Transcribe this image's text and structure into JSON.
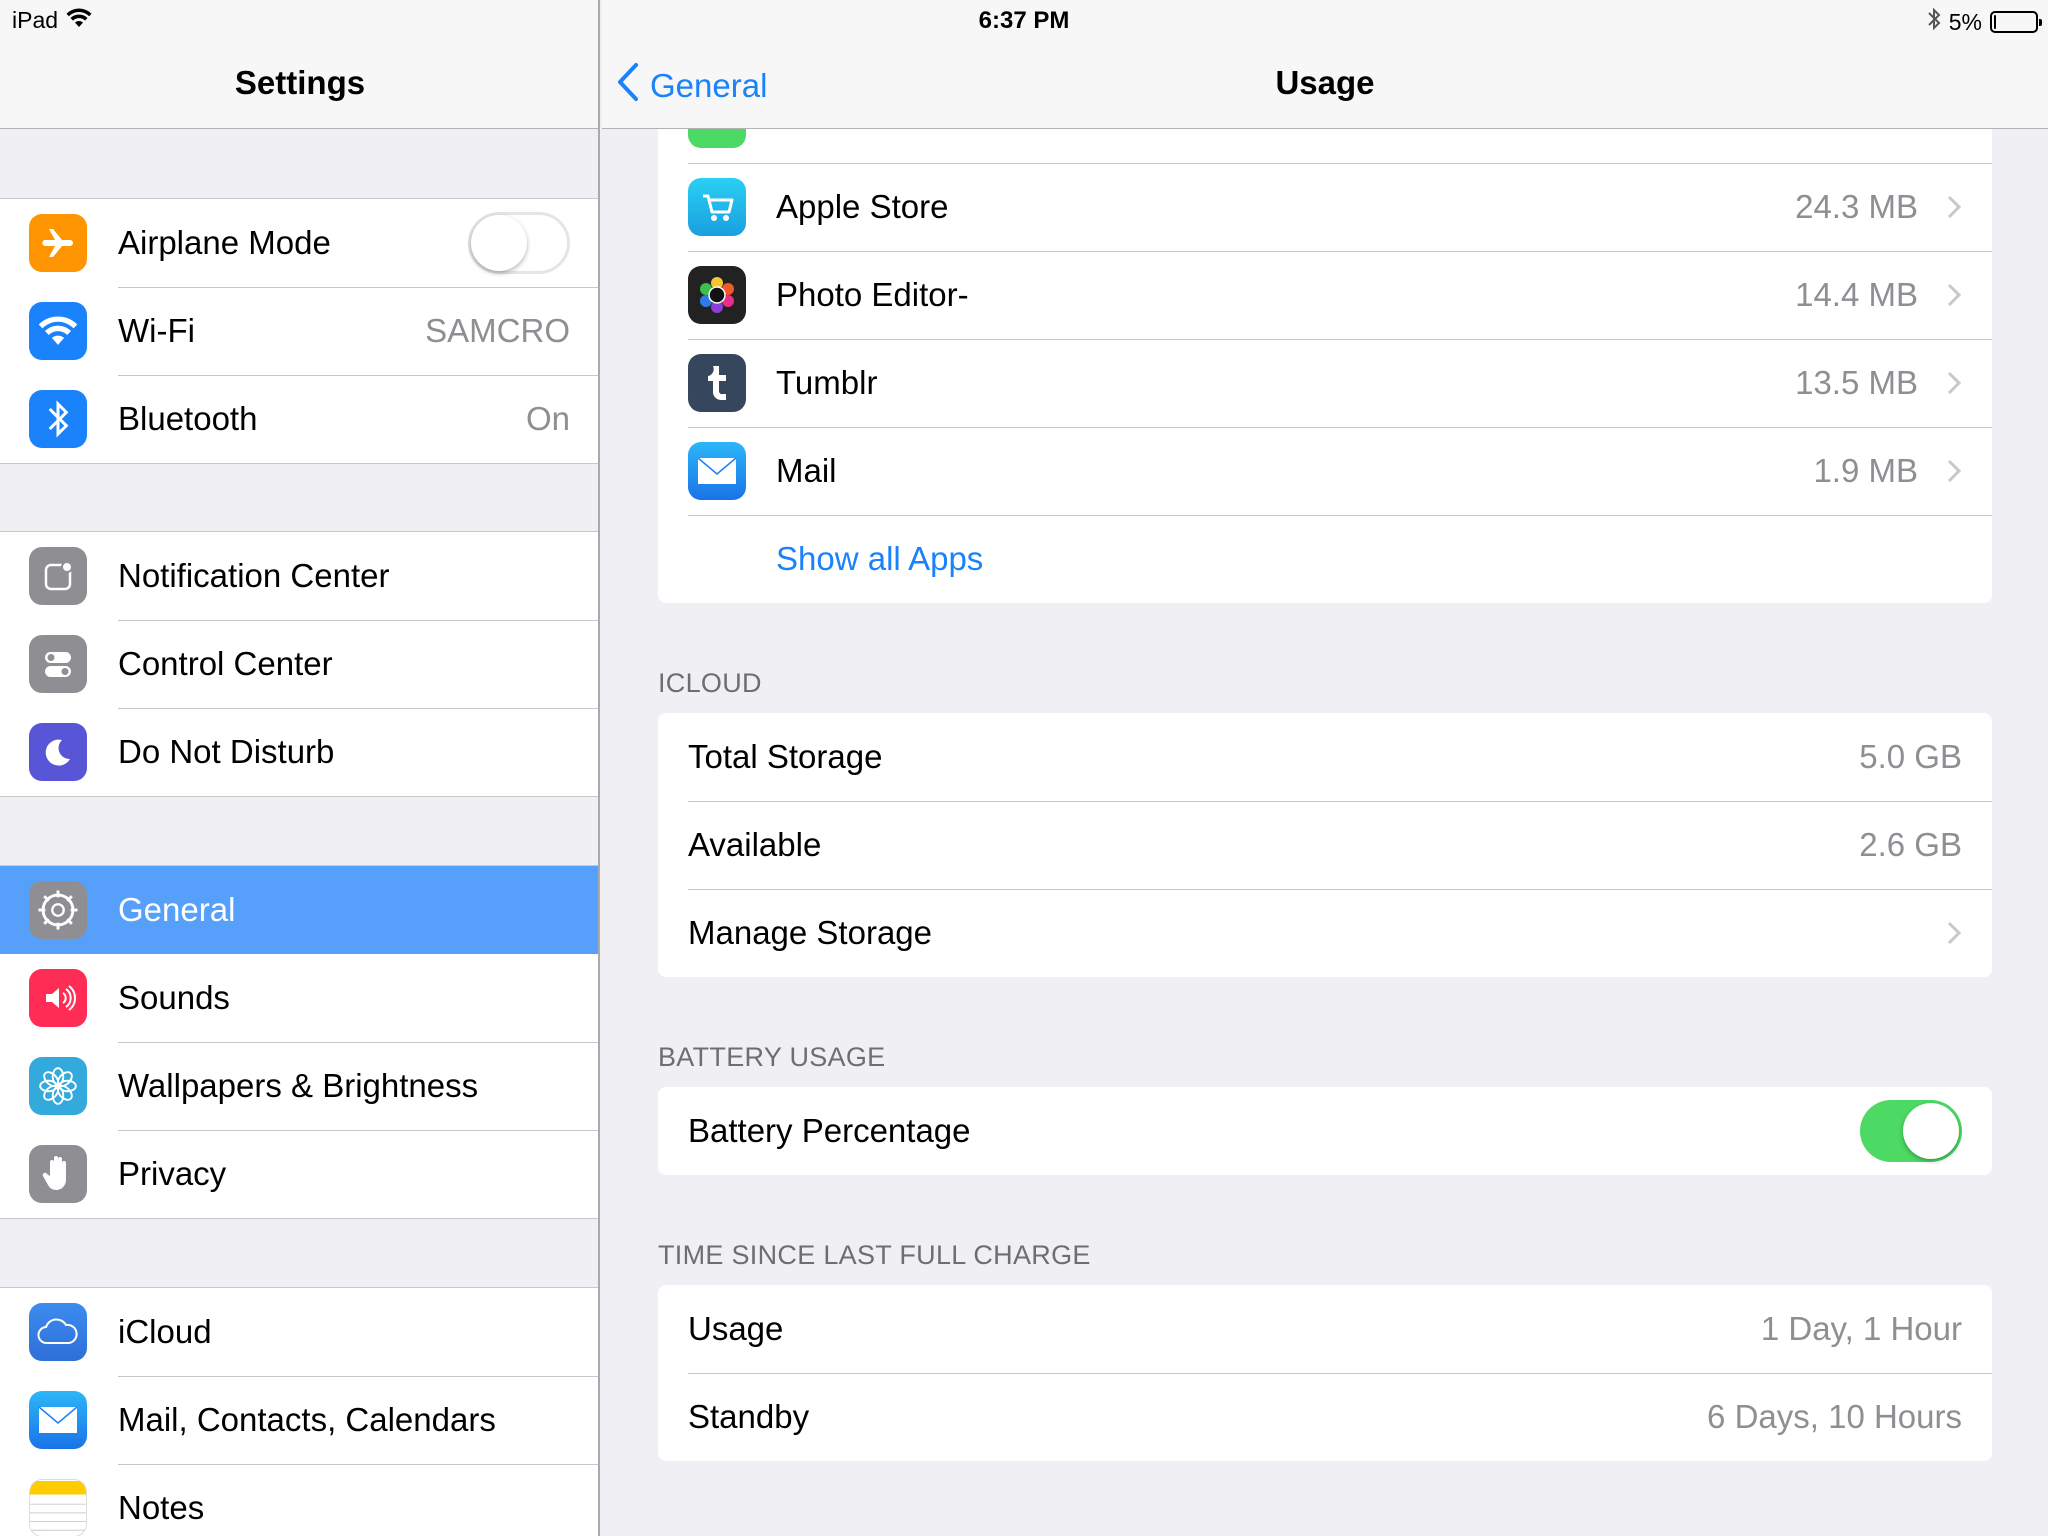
{
  "status_bar": {
    "device": "iPad",
    "time": "6:37 PM",
    "battery_percent": "5%",
    "battery_level": 0.05
  },
  "master": {
    "title": "Settings",
    "groups": [
      [
        {
          "label": "Airplane Mode",
          "icon": "airplane-icon",
          "color": "#ff9500",
          "toggle": false
        },
        {
          "label": "Wi-Fi",
          "icon": "wifi-icon",
          "color": "#1a82fb",
          "value": "SAMCRO"
        },
        {
          "label": "Bluetooth",
          "icon": "bluetooth-icon",
          "color": "#1a82fb",
          "value": "On"
        }
      ],
      [
        {
          "label": "Notification Center",
          "icon": "notification-center-icon",
          "color": "#8e8e93"
        },
        {
          "label": "Control Center",
          "icon": "control-center-icon",
          "color": "#8e8e93"
        },
        {
          "label": "Do Not Disturb",
          "icon": "moon-icon",
          "color": "#5856d6"
        }
      ],
      [
        {
          "label": "General",
          "icon": "gear-icon",
          "color": "#8e8e93",
          "selected": true
        },
        {
          "label": "Sounds",
          "icon": "speaker-icon",
          "color": "#ff2d55"
        },
        {
          "label": "Wallpapers & Brightness",
          "icon": "flower-icon",
          "color": "#34aadc"
        },
        {
          "label": "Privacy",
          "icon": "hand-icon",
          "color": "#8e8e93"
        }
      ],
      [
        {
          "label": "iCloud",
          "icon": "cloud-icon",
          "color": "#1a82fb"
        },
        {
          "label": "Mail, Contacts, Calendars",
          "icon": "mail-icon",
          "color": "#1a82fb"
        },
        {
          "label": "Notes",
          "icon": "notes-icon",
          "color": "#ffcc00"
        }
      ]
    ]
  },
  "detail": {
    "back_label": "General",
    "title": "Usage",
    "apps": [
      {
        "name": "Apple Store",
        "size": "24.3 MB",
        "icon": "apple-store-icon"
      },
      {
        "name": "Photo Editor-",
        "size": "14.4 MB",
        "icon": "photo-editor-icon"
      },
      {
        "name": "Tumblr",
        "size": "13.5 MB",
        "icon": "tumblr-icon"
      },
      {
        "name": "Mail",
        "size": "1.9 MB",
        "icon": "mail-icon"
      }
    ],
    "show_all_apps": "Show all Apps",
    "icloud": {
      "header": "ICLOUD",
      "total_storage_label": "Total Storage",
      "total_storage_value": "5.0 GB",
      "available_label": "Available",
      "available_value": "2.6 GB",
      "manage_storage_label": "Manage Storage"
    },
    "battery": {
      "header": "BATTERY USAGE",
      "battery_percentage_label": "Battery Percentage",
      "battery_percentage_on": true
    },
    "time_since_charge": {
      "header": "TIME SINCE LAST FULL CHARGE",
      "usage_label": "Usage",
      "usage_value": "1 Day, 1 Hour",
      "standby_label": "Standby",
      "standby_value": "6 Days, 10 Hours"
    }
  }
}
